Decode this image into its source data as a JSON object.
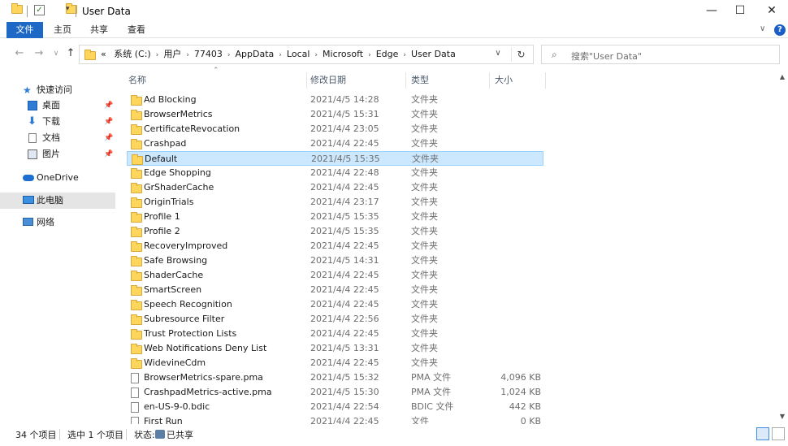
{
  "window": {
    "title": "User Data",
    "minimize": "—",
    "maximize": "☐",
    "close": "✕"
  },
  "ribbon": {
    "tabs": [
      "文件",
      "主页",
      "共享",
      "查看"
    ],
    "help": "?",
    "expand": "∨"
  },
  "nav": {
    "back": "←",
    "forward": "→",
    "recent": "∨",
    "up": "↑"
  },
  "address": {
    "prefix": "«",
    "crumbs": [
      "系统 (C:)",
      "用户",
      "77403",
      "AppData",
      "Local",
      "Microsoft",
      "Edge",
      "User Data"
    ],
    "dropdown": "∨",
    "refresh": "↻"
  },
  "search": {
    "placeholder": "搜索\"User Data\""
  },
  "navpane": {
    "quick_access": "快速访问",
    "desktop": "桌面",
    "downloads": "下载",
    "documents": "文档",
    "pictures": "图片",
    "onedrive": "OneDrive",
    "this_pc": "此电脑",
    "network": "网络"
  },
  "columns": {
    "name": "名称",
    "date": "修改日期",
    "type": "类型",
    "size": "大小"
  },
  "files": [
    {
      "name": "Ad Blocking",
      "date": "2021/4/5 14:28",
      "type": "文件夹",
      "size": "",
      "kind": "folder"
    },
    {
      "name": "BrowserMetrics",
      "date": "2021/4/5 15:31",
      "type": "文件夹",
      "size": "",
      "kind": "folder"
    },
    {
      "name": "CertificateRevocation",
      "date": "2021/4/4 23:05",
      "type": "文件夹",
      "size": "",
      "kind": "folder"
    },
    {
      "name": "Crashpad",
      "date": "2021/4/4 22:45",
      "type": "文件夹",
      "size": "",
      "kind": "folder"
    },
    {
      "name": "Default",
      "date": "2021/4/5 15:35",
      "type": "文件夹",
      "size": "",
      "kind": "folder",
      "selected": true
    },
    {
      "name": "Edge Shopping",
      "date": "2021/4/4 22:48",
      "type": "文件夹",
      "size": "",
      "kind": "folder"
    },
    {
      "name": "GrShaderCache",
      "date": "2021/4/4 22:45",
      "type": "文件夹",
      "size": "",
      "kind": "folder"
    },
    {
      "name": "OriginTrials",
      "date": "2021/4/4 23:17",
      "type": "文件夹",
      "size": "",
      "kind": "folder"
    },
    {
      "name": "Profile 1",
      "date": "2021/4/5 15:35",
      "type": "文件夹",
      "size": "",
      "kind": "folder"
    },
    {
      "name": "Profile 2",
      "date": "2021/4/5 15:35",
      "type": "文件夹",
      "size": "",
      "kind": "folder"
    },
    {
      "name": "RecoveryImproved",
      "date": "2021/4/4 22:45",
      "type": "文件夹",
      "size": "",
      "kind": "folder"
    },
    {
      "name": "Safe Browsing",
      "date": "2021/4/5 14:31",
      "type": "文件夹",
      "size": "",
      "kind": "folder"
    },
    {
      "name": "ShaderCache",
      "date": "2021/4/4 22:45",
      "type": "文件夹",
      "size": "",
      "kind": "folder"
    },
    {
      "name": "SmartScreen",
      "date": "2021/4/4 22:45",
      "type": "文件夹",
      "size": "",
      "kind": "folder"
    },
    {
      "name": "Speech Recognition",
      "date": "2021/4/4 22:45",
      "type": "文件夹",
      "size": "",
      "kind": "folder"
    },
    {
      "name": "Subresource Filter",
      "date": "2021/4/4 22:56",
      "type": "文件夹",
      "size": "",
      "kind": "folder"
    },
    {
      "name": "Trust Protection Lists",
      "date": "2021/4/4 22:45",
      "type": "文件夹",
      "size": "",
      "kind": "folder"
    },
    {
      "name": "Web Notifications Deny List",
      "date": "2021/4/5 13:31",
      "type": "文件夹",
      "size": "",
      "kind": "folder"
    },
    {
      "name": "WidevineCdm",
      "date": "2021/4/4 22:45",
      "type": "文件夹",
      "size": "",
      "kind": "folder"
    },
    {
      "name": "BrowserMetrics-spare.pma",
      "date": "2021/4/5 15:32",
      "type": "PMA 文件",
      "size": "4,096 KB",
      "kind": "file"
    },
    {
      "name": "CrashpadMetrics-active.pma",
      "date": "2021/4/5 15:30",
      "type": "PMA 文件",
      "size": "1,024 KB",
      "kind": "file"
    },
    {
      "name": "en-US-9-0.bdic",
      "date": "2021/4/4 22:54",
      "type": "BDIC 文件",
      "size": "442 KB",
      "kind": "file"
    },
    {
      "name": "First Run",
      "date": "2021/4/4 22:45",
      "type": "文件",
      "size": "0 KB",
      "kind": "file"
    }
  ],
  "status": {
    "count": "34 个项目",
    "selected": "选中 1 个项目",
    "state_label": "状态:",
    "state_value": "已共享"
  }
}
